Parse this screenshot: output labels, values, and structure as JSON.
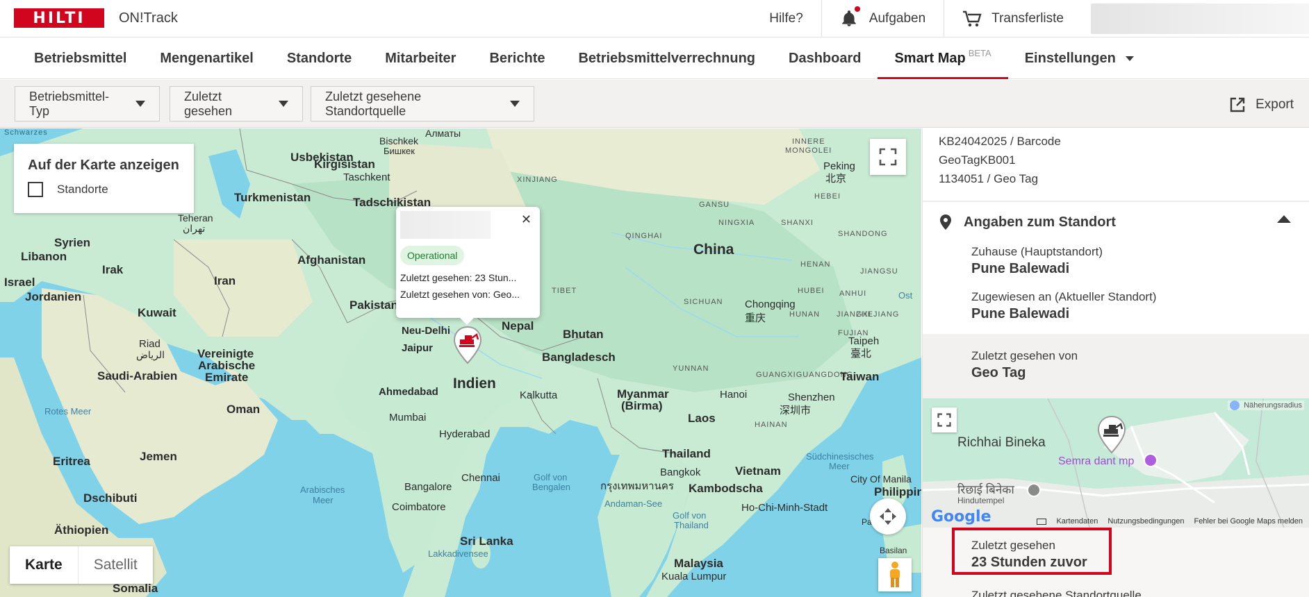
{
  "header": {
    "logo_text": "HILTI",
    "product": "ON!Track",
    "help": "Hilfe?",
    "tasks": "Aufgaben",
    "transfer": "Transferliste"
  },
  "nav": {
    "items": [
      "Betriebsmittel",
      "Mengenartikel",
      "Standorte",
      "Mitarbeiter",
      "Berichte",
      "Betriebsmittelverrechnung",
      "Dashboard"
    ],
    "smart_map": "Smart Map",
    "beta": "BETA",
    "settings": "Einstellungen"
  },
  "filters": {
    "type": "Betriebsmittel-Typ",
    "last_seen": "Zuletzt gesehen",
    "last_source": "Zuletzt gesehene Standortquelle",
    "export": "Export"
  },
  "map_overlay": {
    "title": "Auf der Karte anzeigen",
    "checkbox_label": "Standorte"
  },
  "popup": {
    "status": "Operational",
    "last_seen": "Zuletzt gesehen: 23 Stun...",
    "last_seen_by": "Zuletzt gesehen von: Geo..."
  },
  "map_type": {
    "map": "Karte",
    "satellite": "Satellit"
  },
  "map_labels": {
    "schwarzes": "Schwarzes",
    "usbekistan": "Usbekistan",
    "kirgisistan": "Kirgisistan",
    "bischkek": "Bischkek",
    "bischkek_ru": "Бишкек",
    "almaty": "Алматы",
    "taschkent": "Taschkent",
    "turkmenistan": "Turkmenistan",
    "tadschikistan": "Tadschikistan",
    "teheran": "Teheran",
    "teheran_fa": "تهران",
    "syrien": "Syrien",
    "libanon": "Libanon",
    "irak": "Irak",
    "israel": "Israel",
    "jordanien": "Jordanien",
    "iran": "Iran",
    "afghanistan": "Afghanistan",
    "pakistan": "Pakistan",
    "kuwait": "Kuwait",
    "riad": "Riad",
    "riad_ar": "الرياض",
    "saudi": "Saudi-Arabien",
    "uae1": "Vereinigte",
    "uae2": "Arabische",
    "uae3": "Emirate",
    "oman": "Oman",
    "rotes_meer": "Rotes Meer",
    "jemen": "Jemen",
    "eritrea": "Eritrea",
    "dschibuti": "Dschibuti",
    "aethiopien": "Äthiopien",
    "somalia": "Somalia",
    "arab1": "Arabisches",
    "arab2": "Meer",
    "neu_delhi": "Neu-Delhi",
    "jaipur": "Jaipur",
    "nepal": "Nepal",
    "bhutan": "Bhutan",
    "indien": "Indien",
    "ahmedabad": "Ahmedabad",
    "kalkutta": "Kalkutta",
    "bangladesch": "Bangladesch",
    "mumbai": "Mumbai",
    "hyderabad": "Hyderabad",
    "bangalore": "Bangalore",
    "chennai": "Chennai",
    "coimbatore": "Coimbatore",
    "sri_lanka": "Sri Lanka",
    "lakkadiven": "Lakkadivensee",
    "bengal1": "Golf von",
    "bengal2": "Bengalen",
    "myanmar1": "Myanmar",
    "myanmar2": "(Birma)",
    "laos": "Laos",
    "thailand": "Thailand",
    "bangkok": "Bangkok",
    "bangkok_th": "กรุงเทพมหานคร",
    "kambodscha": "Kambodscha",
    "vietnam": "Vietnam",
    "hanoi": "Hanoi",
    "hcmc": "Ho-Chi-Minh-Stadt",
    "andaman": "Andaman-See",
    "gulf_thai1": "Golf von",
    "gulf_thai2": "Thailand",
    "malaysia": "Malaysia",
    "kl": "Kuala Lumpur",
    "china": "China",
    "xinjiang": "XINJIANG",
    "tibet": "TIBET",
    "qinghai": "QINGHAI",
    "gansu": "GANSU",
    "ningxia": "NINGXIA",
    "shanxi": "SHANXI",
    "shandong": "SHANDONG",
    "henan": "HENAN",
    "jiangsu": "JIANGSU",
    "hubei": "HUBEI",
    "anhui": "ANHUI",
    "sichuan": "SICHUAN",
    "chongqing": "Chongqing",
    "chongqing_zh": "重庆",
    "hunan": "HUNAN",
    "jiangxi": "JIANGXI",
    "zhejiang": "ZHEJIANG",
    "fujian": "FUJIAN",
    "yunnan": "YUNNAN",
    "guangxi": "GUANGXIGUANGDONG",
    "shenzhen": "Shenzhen",
    "shenzhen_zh": "深圳市",
    "hainan": "HAINAN",
    "taiwan": "Taiwan",
    "taipeh": "Taipeh",
    "taipeh_zh": "臺北",
    "peking": "Peking",
    "peking_zh": "北京",
    "hebei": "HEBEI",
    "innere1": "INNERE",
    "innere2": "MONGOLEI",
    "ost": "Ost",
    "suedchin1": "Südchinesisches",
    "suedchin2": "Meer",
    "manila": "City Of Manila",
    "philippin": "Philippin",
    "palawan": "Palawan",
    "basilan": "Basilan"
  },
  "panel": {
    "id1": "KB24042025 / Barcode",
    "id2": "GeoTagKB001",
    "id3": "1134051 / Geo Tag",
    "location_title": "Angaben zum Standort",
    "home_label": "Zuhause (Hauptstandort)",
    "home_value": "Pune Balewadi",
    "assigned_label": "Zugewiesen an (Aktueller Standort)",
    "assigned_value": "Pune Balewadi",
    "seen_by_label": "Zuletzt gesehen von",
    "seen_by_value": "Geo Tag",
    "minimap_radius": "Näherungsradius",
    "minimap_place1": "Richhai Bineka",
    "minimap_place2": "Semra dant mp",
    "minimap_place3": "रिछाई बिनेका",
    "minimap_place4": "Hindutempel",
    "google": "Google",
    "kartendaten": "Kartendaten",
    "nutzung": "Nutzungsbedingungen",
    "fehler": "Fehler bei Google Maps melden",
    "last_seen_label": "Zuletzt gesehen",
    "last_seen_value": "23 Stunden zuvor",
    "last_source_label": "Zuletzt gesehene Standortquelle"
  }
}
